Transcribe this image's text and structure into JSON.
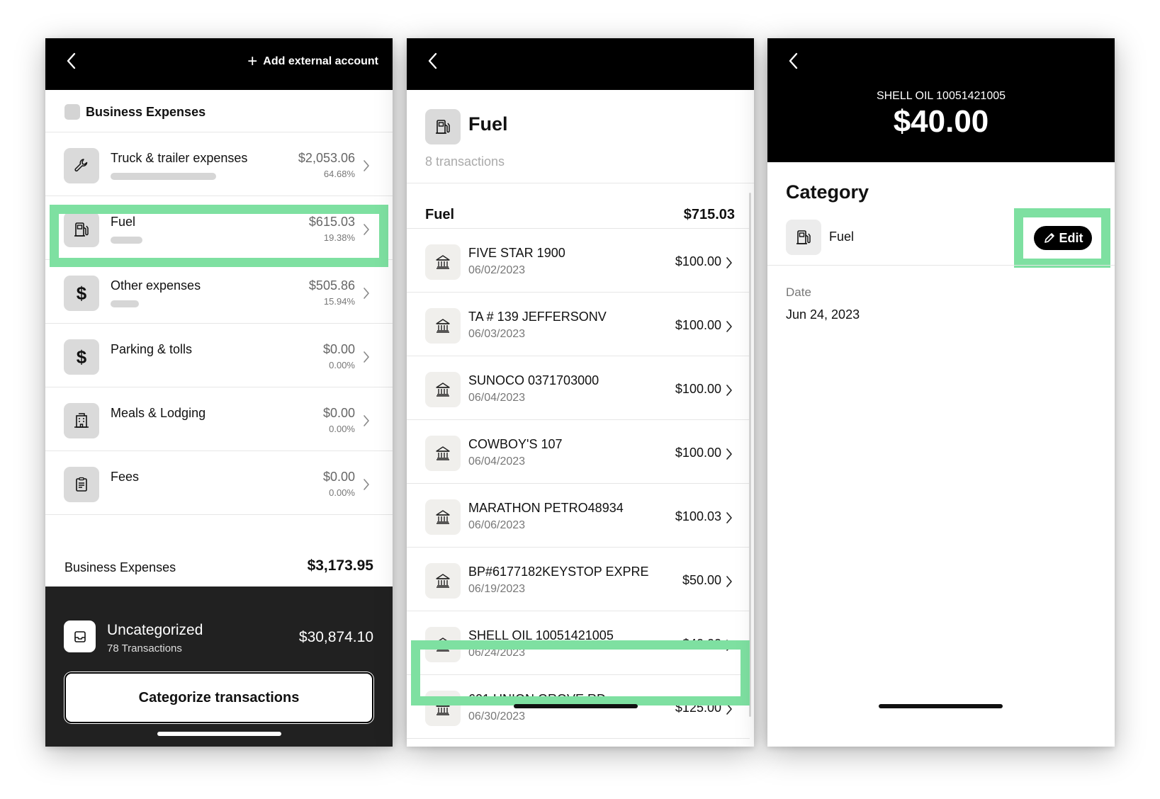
{
  "panel1": {
    "add_external_label": "Add external account",
    "section_title": "Business Expenses",
    "categories": [
      {
        "name": "Truck & trailer expenses",
        "amount": "$2,053.06",
        "pct": "64.68%",
        "share": 0.6468,
        "icon": "wrench-icon"
      },
      {
        "name": "Fuel",
        "amount": "$615.03",
        "pct": "19.38%",
        "share": 0.1938,
        "icon": "fuel-pump-icon"
      },
      {
        "name": "Other expenses",
        "amount": "$505.86",
        "pct": "15.94%",
        "share": 0.1594,
        "icon": "dollar-icon"
      },
      {
        "name": "Parking & tolls",
        "amount": "$0.00",
        "pct": "0.00%",
        "share": 0,
        "icon": "dollar-icon"
      },
      {
        "name": "Meals & Lodging",
        "amount": "$0.00",
        "pct": "0.00%",
        "share": 0,
        "icon": "building-icon"
      },
      {
        "name": "Fees",
        "amount": "$0.00",
        "pct": "0.00%",
        "share": 0,
        "icon": "clipboard-icon"
      }
    ],
    "total_label": "Business Expenses",
    "total_amount": "$3,173.95",
    "uncategorized_title": "Uncategorized",
    "uncategorized_sub": "78 Transactions",
    "uncategorized_amount": "$30,874.10",
    "categorize_button": "Categorize transactions"
  },
  "panel2": {
    "title": "Fuel",
    "subtitle": "8 transactions",
    "group_label": "Fuel",
    "group_amount": "$715.03",
    "transactions": [
      {
        "name": "FIVE STAR 1900",
        "date": "06/02/2023",
        "amount": "$100.00"
      },
      {
        "name": "TA # 139 JEFFERSONV",
        "date": "06/03/2023",
        "amount": "$100.00"
      },
      {
        "name": "SUNOCO 0371703000",
        "date": "06/04/2023",
        "amount": "$100.00"
      },
      {
        "name": "COWBOY'S 107",
        "date": "06/04/2023",
        "amount": "$100.00"
      },
      {
        "name": "MARATHON PETRO48934",
        "date": "06/06/2023",
        "amount": "$100.03"
      },
      {
        "name": "BP#6177182KEYSTOP EXPRE",
        "date": "06/19/2023",
        "amount": "$50.00"
      },
      {
        "name": "SHELL OIL 10051421005",
        "date": "06/24/2023",
        "amount": "$40.00"
      },
      {
        "name": "601 UNION GROVE RD.",
        "date": "06/30/2023",
        "amount": "$125.00"
      }
    ]
  },
  "panel3": {
    "merchant": "SHELL OIL 10051421005",
    "amount": "$40.00",
    "category_heading": "Category",
    "category_value": "Fuel",
    "edit_label": "Edit",
    "date_label": "Date",
    "date_value": "Jun 24, 2023"
  },
  "colors": {
    "highlight": "#7ee0a1",
    "header_bg": "#000000",
    "footer_bg": "#212121"
  }
}
